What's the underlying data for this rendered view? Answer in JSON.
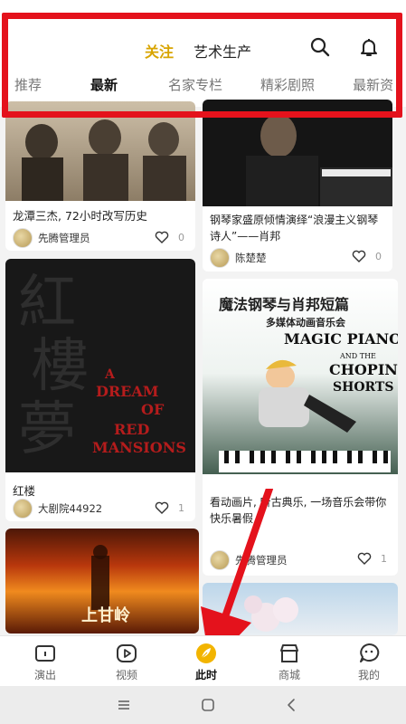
{
  "header": {
    "top_tabs": [
      "关注",
      "艺术生产"
    ],
    "active_top_tab": "关注",
    "sub_tabs": [
      "推荐",
      "最新",
      "名家专栏",
      "精彩剧照",
      "最新资"
    ],
    "active_sub_tab": "最新",
    "search_icon": "search-icon",
    "bell_icon": "bell-icon"
  },
  "feed": {
    "left": [
      {
        "title": "龙潭三杰, 72小时改写历史",
        "user": "先腾管理员",
        "likes": "0"
      },
      {
        "title": "红楼",
        "user": "大剧院44922",
        "likes": "1",
        "poster_text": [
          "A",
          "DREAM",
          "OF",
          "RED",
          "MANSIONS"
        ],
        "poster_chinese": "紅樓夢"
      },
      {
        "poster_text": "上甘岭"
      }
    ],
    "right": [
      {
        "title": "钢琴家盛原倾情演绎“浪漫主义钢琴诗人”——肖邦",
        "user": "陈楚楚",
        "likes": "0"
      },
      {
        "title": "看动画片, 听古典乐, 一场音乐会带你快乐暑假",
        "user": "先腾管理员",
        "likes": "1",
        "poster_title_cn": "魔法钢琴与肖邦短篇",
        "poster_sub_cn": "多媒体动画音乐会",
        "poster_en": [
          "MAGIC PIANO",
          "AND THE",
          "CHOPIN",
          "SHORTS"
        ]
      }
    ]
  },
  "nav": {
    "items": [
      "演出",
      "视频",
      "此时",
      "商城",
      "我的"
    ],
    "active": "此时"
  },
  "colors": {
    "accent": "#d8a400",
    "highlight": "#e4121c"
  }
}
